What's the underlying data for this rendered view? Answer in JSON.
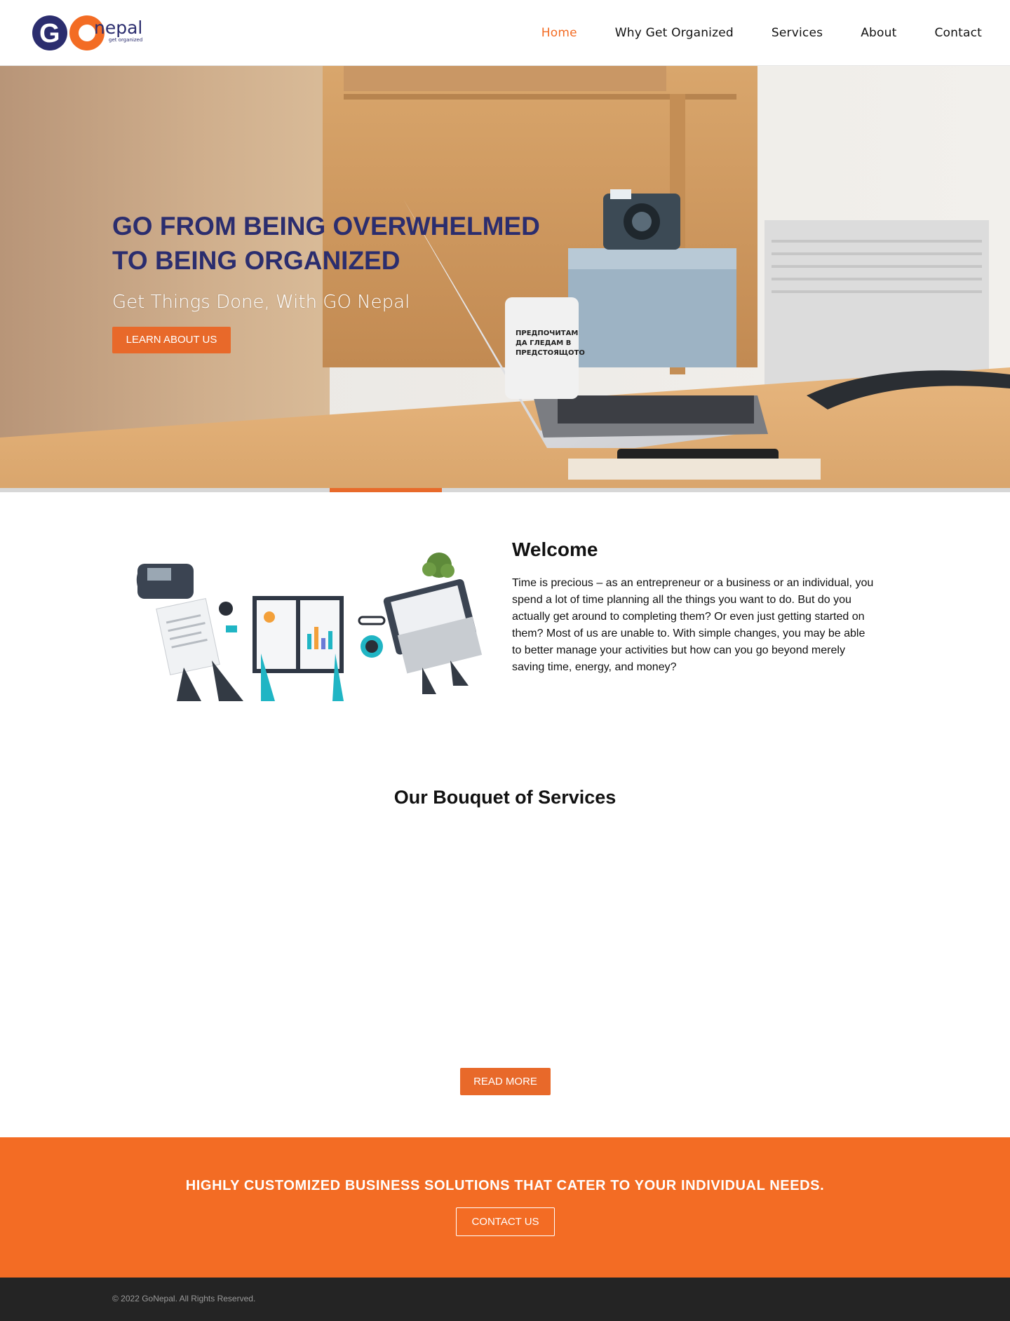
{
  "header": {
    "logo": {
      "brand": "GOnepal",
      "go": "GO",
      "name": "nepal",
      "tagline": "get organized"
    },
    "nav": [
      "Home",
      "Why Get Organized",
      "Services",
      "About",
      "Contact"
    ],
    "active_index": 0
  },
  "hero": {
    "title_line1": "GO FROM BEING OVERWHELMED",
    "title_line2": "TO BEING ORGANIZED",
    "subtitle": "Get Things Done, With GO Nepal",
    "button": "LEARN ABOUT US",
    "mug_text": [
      "ПРЕДПОЧИТАМ",
      "ДА ГЛЕДАМ В",
      "ПРЕДСТОЯЩОТО"
    ]
  },
  "welcome": {
    "title": "Welcome",
    "body": "Time is precious – as an entrepreneur or a business or an individual, you spend a lot of time planning all the things you want to do. But do you actually get around to completing them? Or even just getting started on them? Most of us are unable to. With simple changes, you may be able to better manage your activities but how can you go beyond merely saving time, energy, and money?"
  },
  "services": {
    "title": "Our Bouquet of Services",
    "button": "READ MORE"
  },
  "cta": {
    "title": "HIGHLY CUSTOMIZED BUSINESS SOLUTIONS THAT CATER TO YOUR INDIVIDUAL NEEDS.",
    "button": "CONTACT US"
  },
  "footer": {
    "copyright": "© 2022 GoNepal. All Rights Reserved."
  },
  "colors": {
    "accent": "#f36c24",
    "navy": "#2b2d6e",
    "footer_bg": "#242424"
  }
}
